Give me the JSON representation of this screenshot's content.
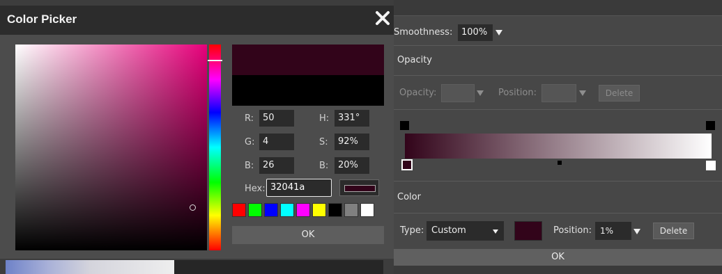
{
  "color_picker": {
    "title": "Color Picker",
    "close_icon": "close-icon",
    "fields": {
      "r_label": "R:",
      "r_value": "50",
      "g_label": "G:",
      "g_value": "4",
      "b_label": "B:",
      "b_value": "26",
      "h_label": "H:",
      "h_value": "331°",
      "s_label": "S:",
      "s_value": "92%",
      "v_label": "B:",
      "v_value": "20%",
      "hex_label": "Hex:",
      "hex_value": "32041a"
    },
    "current_color": "#32041a",
    "previous_color": "#000000",
    "swatches": [
      "#ff0000",
      "#00ff00",
      "#0000ff",
      "#00ffff",
      "#ff00ff",
      "#ffff00",
      "#000000",
      "#808080",
      "#ffffff"
    ],
    "ok_label": "OK"
  },
  "gradient_panel": {
    "smoothness_label": "Smoothness:",
    "smoothness_value": "100%",
    "opacity_section": {
      "heading": "Opacity",
      "opacity_label": "Opacity:",
      "position_label": "Position:",
      "delete_label": "Delete"
    },
    "gradient": {
      "start_color": "#32041a",
      "end_color": "#ffffff"
    },
    "color_section": {
      "heading": "Color",
      "type_label": "Type:",
      "type_value": "Custom",
      "color_swatch": "#32041a",
      "position_label": "Position:",
      "position_value": "1%",
      "delete_label": "Delete"
    },
    "ok_label": "OK"
  }
}
